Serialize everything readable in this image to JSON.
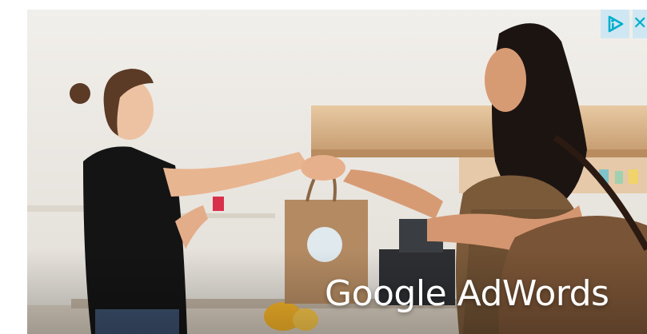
{
  "ad": {
    "brand_text": "Google AdWords",
    "close_glyph": "✕",
    "adchoices_icon": "adchoices-icon",
    "colors": {
      "adchoices": "#00aecd",
      "adchoices_bg": "#cfe7f2",
      "brand_text": "#ffffff"
    }
  }
}
